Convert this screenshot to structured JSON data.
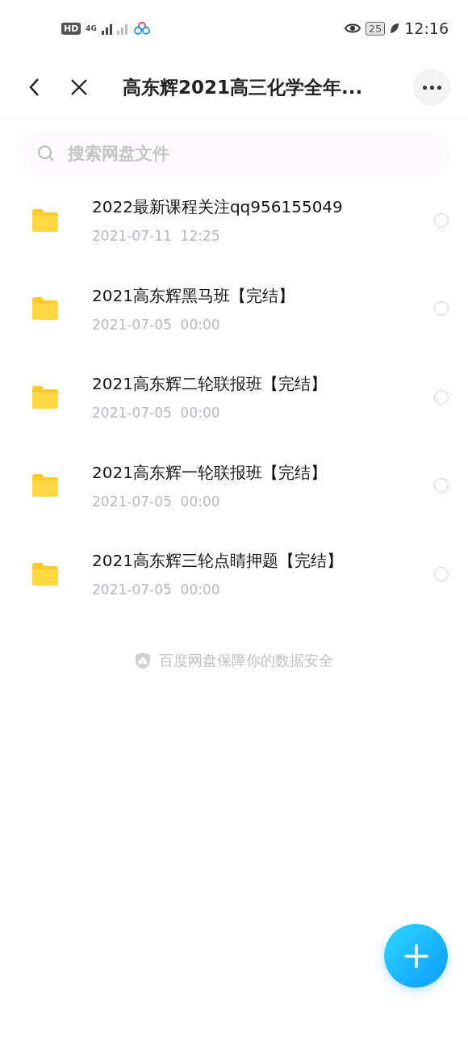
{
  "status_bar": {
    "hd_badge": "HD",
    "network": "4G",
    "battery": "25",
    "time": "12:16"
  },
  "header": {
    "title": "高东辉2021高三化学全年..."
  },
  "search": {
    "placeholder": "搜索网盘文件"
  },
  "files": [
    {
      "name": "2022最新课程关注qq956155049",
      "date": "2021-07-11  12:25",
      "selected": false
    },
    {
      "name": "2021高东辉黑马班【完结】",
      "date": "2021-07-05  00:00",
      "selected": false
    },
    {
      "name": "2021高东辉二轮联报班【完结】",
      "date": "2021-07-05  00:00",
      "selected": false
    },
    {
      "name": "2021高东辉一轮联报班【完结】",
      "date": "2021-07-05  00:00",
      "selected": false
    },
    {
      "name": "2021高东辉三轮点睛押题【完结】",
      "date": "2021-07-05  00:00",
      "selected": false
    }
  ],
  "footer_note": "百度网盘保障你的数据安全"
}
